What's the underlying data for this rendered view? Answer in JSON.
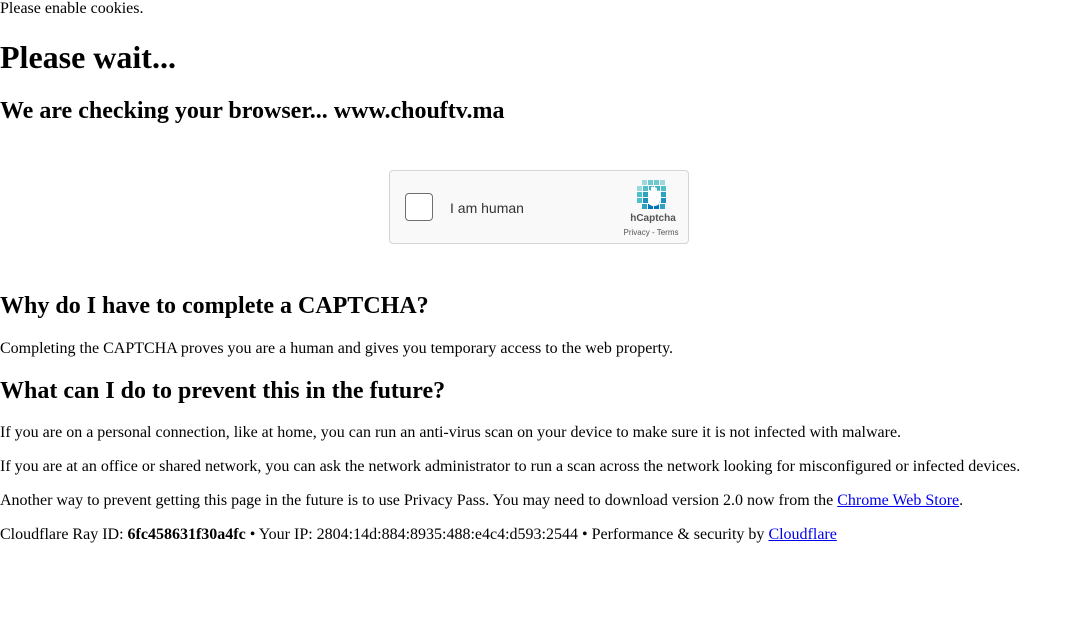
{
  "cookie_notice": "Please enable cookies.",
  "title": "Please wait...",
  "checking": "We are checking your browser... www.chouftv.ma",
  "captcha": {
    "label": "I am human",
    "brand": "hCaptcha",
    "privacy": "Privacy",
    "separator": " - ",
    "terms": "Terms",
    "logo_icon": "hcaptcha-hand-icon",
    "colors": {
      "logo_light": "#4fc0c8",
      "logo_dark": "#0074bf"
    }
  },
  "section1": {
    "heading": "Why do I have to complete a CAPTCHA?",
    "text": "Completing the CAPTCHA proves you are a human and gives you temporary access to the web property."
  },
  "section2": {
    "heading": "What can I do to prevent this in the future?",
    "p1": "If you are on a personal connection, like at home, you can run an anti-virus scan on your device to make sure it is not infected with malware.",
    "p2": "If you are at an office or shared network, you can ask the network administrator to run a scan across the network looking for misconfigured or infected devices.",
    "p3_prefix": "Another way to prevent getting this page in the future is to use Privacy Pass. You may need to download version 2.0 now from the ",
    "p3_link": "Chrome Web Store",
    "p3_suffix": "."
  },
  "footer": {
    "ray_label": "Cloudflare Ray ID: ",
    "ray_id": "6fc458631f30a4fc",
    "ip_text": " • Your IP: 2804:14d:884:8935:488:e4c4:d593:2544 • Performance & security by ",
    "cloudflare_link": "Cloudflare"
  }
}
